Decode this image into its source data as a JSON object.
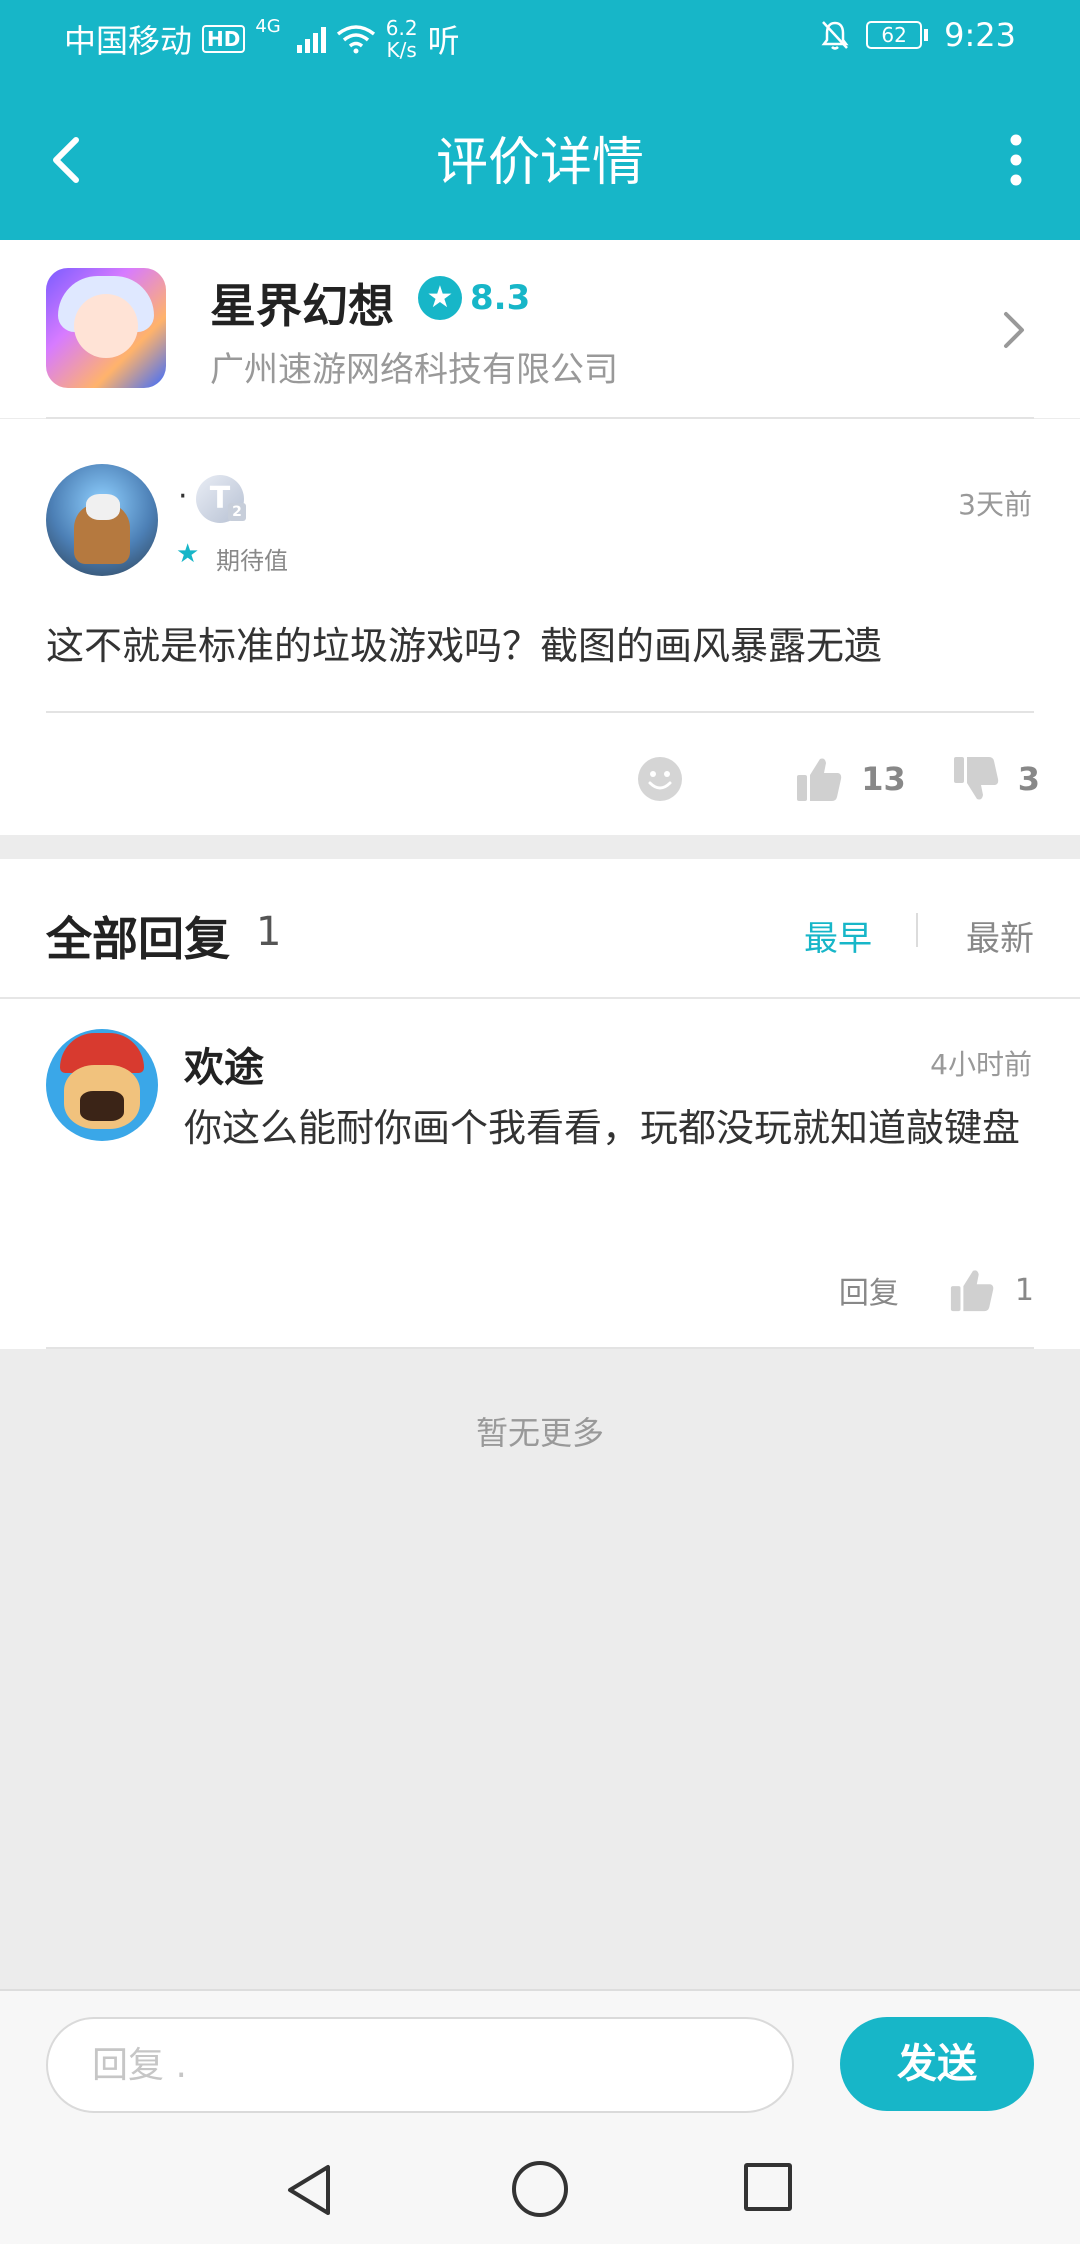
{
  "status_bar": {
    "carrier": "中国移动",
    "hd": "HD",
    "network": "4G",
    "speed_value": "6.2",
    "speed_unit": "K/s",
    "extra_icon": "听",
    "battery": "62",
    "time": "9:23"
  },
  "header": {
    "title": "评价详情"
  },
  "app": {
    "name": "星界幻想",
    "rating": "8.3",
    "company": "广州速游网络科技有限公司"
  },
  "review": {
    "username": "·",
    "level_letter": "T",
    "level_num": "2",
    "tag": "期待值",
    "time": "3天前",
    "text": "这不就是标准的垃圾游戏吗？截图的画风暴露无遗",
    "likes": "13",
    "dislikes": "3"
  },
  "replies": {
    "title": "全部回复",
    "count": "1",
    "sort_early": "最早",
    "sort_new": "最新",
    "items": [
      {
        "name": "欢途",
        "time": "4小时前",
        "text": "你这么能耐你画个我看看，玩都没玩就知道敲键盘",
        "reply_label": "回复",
        "likes": "1"
      }
    ],
    "no_more": "暂无更多"
  },
  "input": {
    "placeholder": "回复 .",
    "send_label": "发送"
  },
  "colors": {
    "accent": "#17b6c8"
  }
}
